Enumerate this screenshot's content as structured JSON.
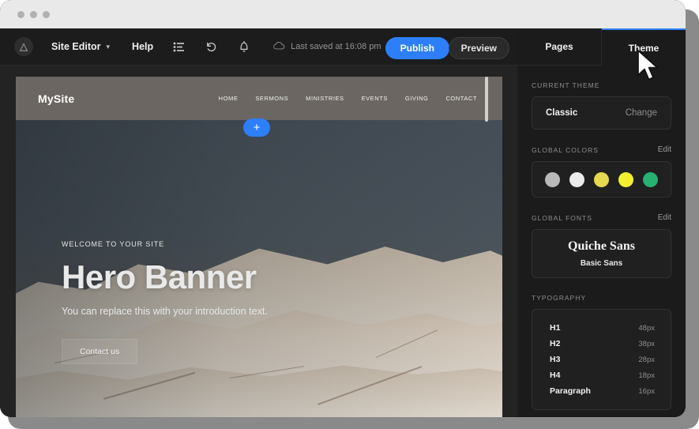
{
  "window": {
    "dots_count": 3
  },
  "toolbar": {
    "logo_glyph": "△",
    "site_editor_label": "Site Editor",
    "chevron_glyph": "▾",
    "help_label": "Help",
    "icons": [
      {
        "name": "pages-list-icon",
        "glyph": "☰"
      },
      {
        "name": "undo-icon",
        "glyph": "↺"
      },
      {
        "name": "bell-icon",
        "glyph": "🔔"
      }
    ],
    "cloud_glyph": "☁",
    "save_status": "Last saved at 16:08 pm",
    "publish_label": "Publish",
    "preview_label": "Preview",
    "publish_color": "#2d7ff9"
  },
  "canvas": {
    "site": {
      "logo": "MySite",
      "nav_items": [
        "HOME",
        "SERMONS",
        "MINISTRIES",
        "EVENTS",
        "GIVING",
        "CONTACT"
      ],
      "hero": {
        "eyebrow": "WELCOME TO YOUR SITE",
        "title": "Hero Banner",
        "subtitle": "You can replace this with your introduction text.",
        "cta_label": "Contact us"
      }
    },
    "add_section_glyph": "+"
  },
  "sidebar": {
    "tabs": [
      {
        "label": "Pages",
        "active": false
      },
      {
        "label": "Theme",
        "active": true
      }
    ],
    "active_accent": "#2d7ff9",
    "current_theme": {
      "section_label": "CURRENT THEME",
      "name": "Classic",
      "change_label": "Change"
    },
    "global_colors": {
      "section_label": "GLOBAL COLORS",
      "edit_label": "Edit",
      "swatches": [
        "#b9b9b9",
        "#ececec",
        "#e6d84f",
        "#f3ef2e",
        "#27b173"
      ]
    },
    "global_fonts": {
      "section_label": "GLOBAL FONTS",
      "edit_label": "Edit",
      "heading_font": "Quiche Sans",
      "body_font": "Basic Sans"
    },
    "typography": {
      "section_label": "TYPOGRAPHY",
      "rows": [
        {
          "name": "H1",
          "size": "48px"
        },
        {
          "name": "H2",
          "size": "38px"
        },
        {
          "name": "H3",
          "size": "28px"
        },
        {
          "name": "H4",
          "size": "18px"
        },
        {
          "name": "Paragraph",
          "size": "16px"
        }
      ]
    }
  }
}
